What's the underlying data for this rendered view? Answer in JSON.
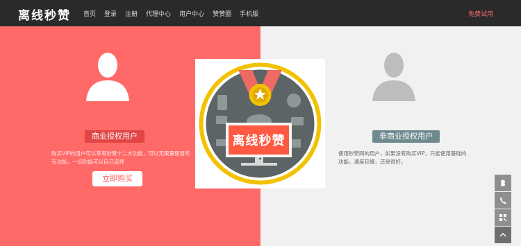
{
  "header": {
    "logo": "离线秒赞",
    "nav": [
      "首页",
      "登录",
      "注册",
      "代理中心",
      "用户中心",
      "赞赞圈",
      "手机版"
    ],
    "login_link": "免费试用"
  },
  "left": {
    "badge": "商业授权用户",
    "desc": "购买VIP的用户可以享有秒赞十二大功能，可以无限量使用所有功能，一切功能可以自己选择",
    "button": "立即购买"
  },
  "right": {
    "badge": "非商业授权用户",
    "desc": "使用秒赞网的用户，如果没有购买VIP，只能使用基础的功能，速度较慢，还是很好。"
  },
  "emblem": {
    "title": "离线秒赞"
  },
  "side_tools": [
    "qq-icon",
    "phone-icon",
    "qrcode-icon",
    "back-to-top-icon"
  ],
  "colors": {
    "left_bg": "#ff6a69",
    "right_bg": "#f1f1f1",
    "header_bg": "#2a2a2a",
    "accent": "#f2c200"
  }
}
